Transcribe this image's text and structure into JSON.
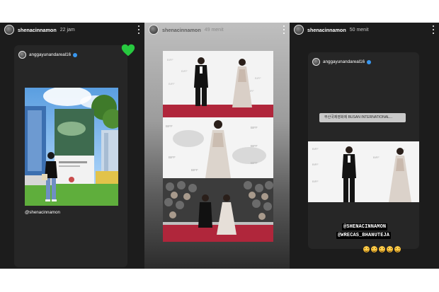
{
  "stories": [
    {
      "username": "shenacinnamon",
      "time": "22 jam",
      "reposted_user": "anggayunandareal16",
      "mention": "@shenacinnamon",
      "sticker": "green-heart"
    },
    {
      "username": "shenacinnamon",
      "time": "49 menit"
    },
    {
      "username": "shenacinnamon",
      "time": "50 menit",
      "reposted_user": "anggayunandareal16",
      "location_tag": "부산국제영화제 BUSAN INTERNATIONAL...",
      "mentions": [
        "@SHENACINNAMON",
        "@WRECAS_BHANUTEJA"
      ],
      "emoji_count": 5
    }
  ],
  "colors": {
    "panel_dark": "#1c1c1c",
    "card_dark": "#262626",
    "red_carpet": "#b0263b",
    "verified_blue": "#3897f0",
    "heart_green": "#27c93f"
  }
}
